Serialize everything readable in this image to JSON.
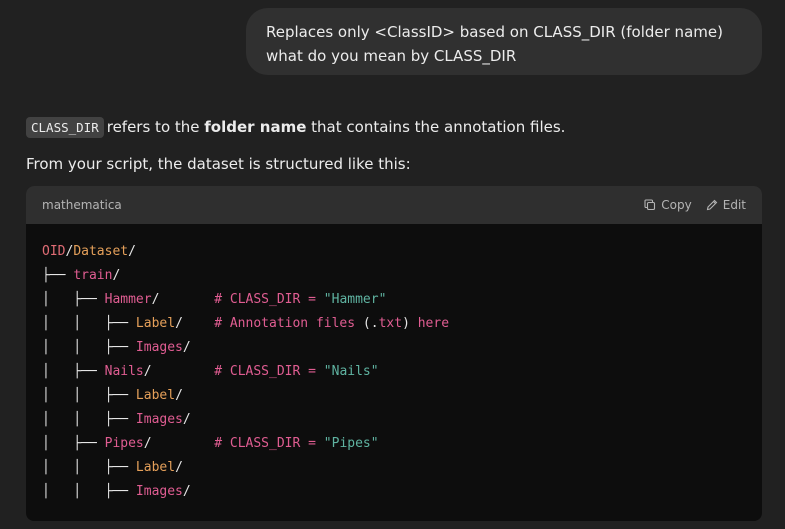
{
  "user_message": {
    "text": "Replaces only <ClassID> based on CLASS_DIR (folder name) what do you mean by CLASS_DIR"
  },
  "assistant": {
    "p1": {
      "code": "CLASS_DIR",
      "text_a": "refers to the ",
      "bold": "folder name",
      "text_b": " that contains the annotation files."
    },
    "p2": "From your script, the dataset is structured like this:"
  },
  "code_block": {
    "language": "mathematica",
    "copy_label": "Copy",
    "edit_label": "Edit",
    "lines": [
      [
        {
          "t": "OID",
          "c": "red"
        },
        {
          "t": "/",
          "c": "white"
        },
        {
          "t": "Dataset",
          "c": "orange"
        },
        {
          "t": "/",
          "c": "white"
        }
      ],
      [
        {
          "t": "├── ",
          "c": "white"
        },
        {
          "t": "train",
          "c": "pink"
        },
        {
          "t": "/",
          "c": "white"
        }
      ],
      [
        {
          "t": "│   ├── ",
          "c": "white"
        },
        {
          "t": "Hammer",
          "c": "pink"
        },
        {
          "t": "/       ",
          "c": "white"
        },
        {
          "t": "# CLASS_DIR = ",
          "c": "pink"
        },
        {
          "t": "\"Hammer\"",
          "c": "green"
        }
      ],
      [
        {
          "t": "│   │   ├── ",
          "c": "white"
        },
        {
          "t": "Label",
          "c": "orange"
        },
        {
          "t": "/    ",
          "c": "white"
        },
        {
          "t": "# Annotation files ",
          "c": "pink"
        },
        {
          "t": "(.",
          "c": "white"
        },
        {
          "t": "txt",
          "c": "pink"
        },
        {
          "t": ") ",
          "c": "white"
        },
        {
          "t": "here",
          "c": "pink"
        }
      ],
      [
        {
          "t": "│   │   ├── ",
          "c": "white"
        },
        {
          "t": "Images",
          "c": "pink"
        },
        {
          "t": "/",
          "c": "white"
        }
      ],
      [
        {
          "t": "│   ├── ",
          "c": "white"
        },
        {
          "t": "Nails",
          "c": "pink"
        },
        {
          "t": "/        ",
          "c": "white"
        },
        {
          "t": "# CLASS_DIR = ",
          "c": "pink"
        },
        {
          "t": "\"Nails\"",
          "c": "green"
        }
      ],
      [
        {
          "t": "│   │   ├── ",
          "c": "white"
        },
        {
          "t": "Label",
          "c": "orange"
        },
        {
          "t": "/",
          "c": "white"
        }
      ],
      [
        {
          "t": "│   │   ├── ",
          "c": "white"
        },
        {
          "t": "Images",
          "c": "pink"
        },
        {
          "t": "/",
          "c": "white"
        }
      ],
      [
        {
          "t": "│   ├── ",
          "c": "white"
        },
        {
          "t": "Pipes",
          "c": "pink"
        },
        {
          "t": "/        ",
          "c": "white"
        },
        {
          "t": "# CLASS_DIR = ",
          "c": "pink"
        },
        {
          "t": "\"Pipes\"",
          "c": "green"
        }
      ],
      [
        {
          "t": "│   │   ├── ",
          "c": "white"
        },
        {
          "t": "Label",
          "c": "orange"
        },
        {
          "t": "/",
          "c": "white"
        }
      ],
      [
        {
          "t": "│   │   ├── ",
          "c": "white"
        },
        {
          "t": "Images",
          "c": "pink"
        },
        {
          "t": "/",
          "c": "white"
        }
      ]
    ]
  },
  "colors": {
    "red": "#e06c75",
    "pink": "#e05d92",
    "orange": "#e5a05a",
    "green": "#5fb3a1",
    "white": "#e6e6e6"
  },
  "icons": {
    "copy": "copy-icon",
    "edit": "pencil-icon"
  }
}
